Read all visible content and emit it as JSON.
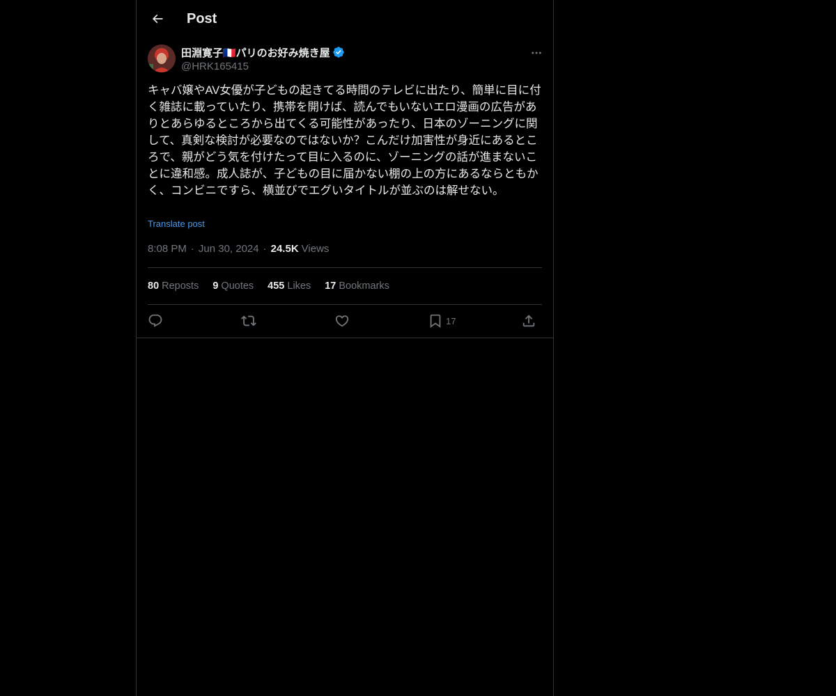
{
  "header": {
    "title": "Post",
    "back_icon": "arrow-left-icon"
  },
  "author": {
    "name": "田淵寛子🇫🇷パリのお好み焼き屋",
    "handle": "@HRK165415",
    "verified": true,
    "avatar_color": "#b0322a"
  },
  "post": {
    "text": "キャバ嬢やAV女優が子どもの起きてる時間のテレビに出たり、簡単に目に付く雑誌に載っていたり、携帯を開けば、読んでもいないエロ漫画の広告がありとあらゆるところから出てくる可能性があったり、日本のゾーニングに関して、真剣な検討が必要なのではないか？こんだけ加害性が身近にあるところで、親がどう気を付けたって目に入るのに、ゾーニングの話が進まないことに違和感。成人誌が、子どもの目に届かない棚の上の方にあるならともかく、コンビニですら、横並びでエグいタイトルが並ぶのは解せない。",
    "translate_label": "Translate post",
    "time": "8:08 PM",
    "date": "Jun 30, 2024",
    "separator": "·",
    "views_count": "24.5K",
    "views_label": "Views"
  },
  "stats": {
    "reposts_count": "80",
    "reposts_label": "Reposts",
    "quotes_count": "9",
    "quotes_label": "Quotes",
    "likes_count": "455",
    "likes_label": "Likes",
    "bookmarks_count": "17",
    "bookmarks_label": "Bookmarks"
  },
  "actions": {
    "reply_icon": "reply-icon",
    "repost_icon": "repost-icon",
    "like_icon": "heart-icon",
    "bookmark_icon": "bookmark-icon",
    "bookmark_count": "17",
    "share_icon": "share-icon"
  },
  "colors": {
    "background": "#000000",
    "text": "#e7e9ea",
    "muted": "#71767b",
    "link": "#4a99e9",
    "verified": "#1d9bf0",
    "border": "#2f3336"
  }
}
